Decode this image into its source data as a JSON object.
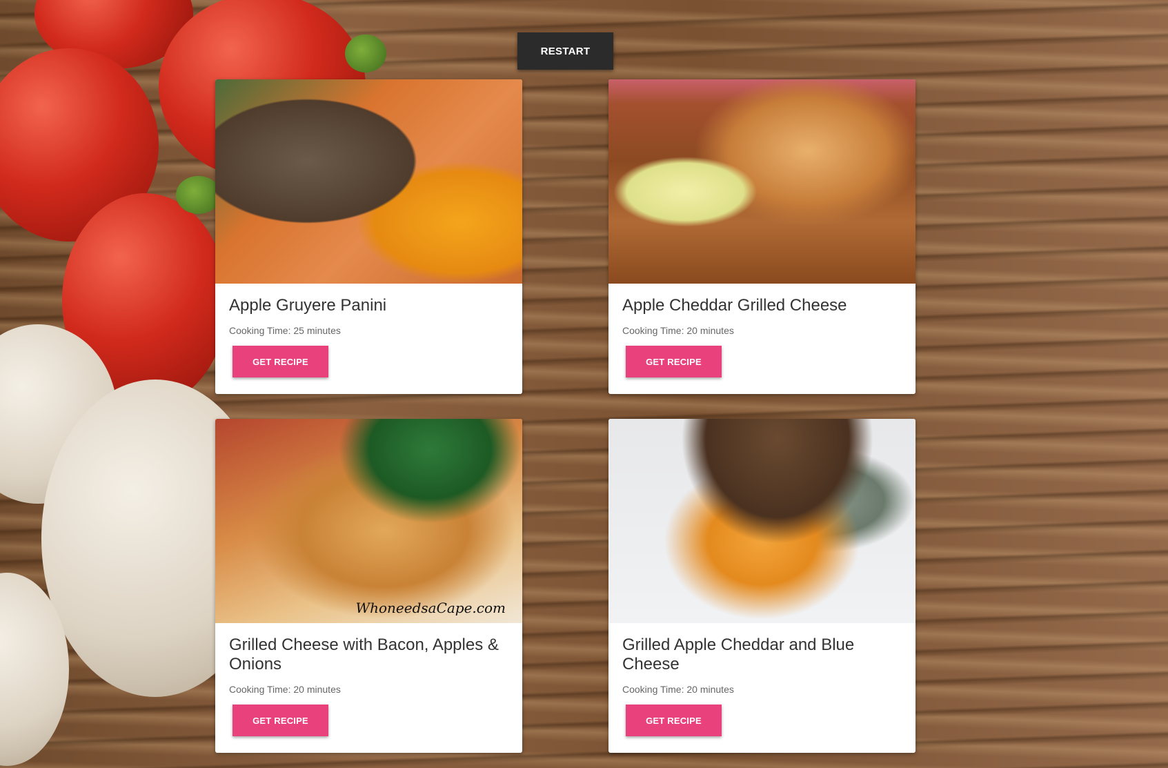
{
  "restart_label": "RESTART",
  "accent_color": "#e9417c",
  "cards": [
    {
      "title": "Apple Gruyere Panini",
      "meta": "Cooking Time: 25 minutes",
      "button": "GET RECIPE"
    },
    {
      "title": "Apple Cheddar Grilled Cheese",
      "meta": "Cooking Time: 20 minutes",
      "button": "GET RECIPE"
    },
    {
      "title": "Grilled Cheese with Bacon, Apples & Onions",
      "meta": "Cooking Time: 20 minutes",
      "button": "GET RECIPE",
      "watermark": "WhoneedsaCape.com"
    },
    {
      "title": "Grilled Apple Cheddar and Blue Cheese",
      "meta": "Cooking Time: 20 minutes",
      "button": "GET RECIPE"
    }
  ]
}
